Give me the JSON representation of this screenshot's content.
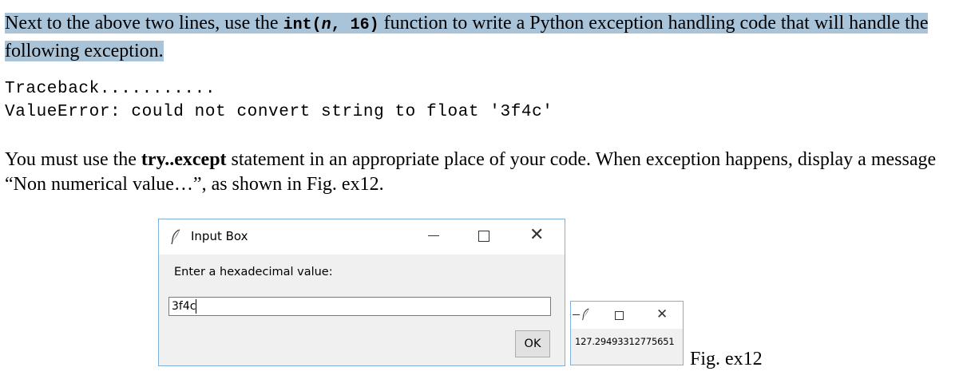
{
  "instruction": {
    "before_code": "Next to the above two lines, use the ",
    "code_fn": "int(",
    "code_arg": "n",
    "code_rest": ", 16)",
    "after_code": " function to write a Python exception handling code that will handle the following exception."
  },
  "traceback": {
    "line1": "Traceback...........",
    "line2": "ValueError: could not convert string to float '3f4c'"
  },
  "requirement": {
    "before_bold": "You must use the ",
    "bold": "try..except",
    "after_bold": " statement in an appropriate place of your code. When exception happens, display a message “Non numerical value…”, as shown in Fig. ex12."
  },
  "input_dialog": {
    "title": "Input Box",
    "prompt": "Enter a hexadecimal value:",
    "input_value": "3f4c",
    "ok_label": "OK",
    "icons": [
      "feather-icon",
      "minimize-icon",
      "maximize-icon",
      "close-icon"
    ]
  },
  "result_window": {
    "value": "127.29493312775651",
    "icons": [
      "feather-icon",
      "minimize-icon",
      "maximize-icon",
      "close-icon"
    ]
  },
  "figure_label": "Fig. ex12",
  "colors": {
    "highlight": "#a9c3d8",
    "window_border": "#7fb0dc",
    "window_body": "#f0f0f0"
  }
}
